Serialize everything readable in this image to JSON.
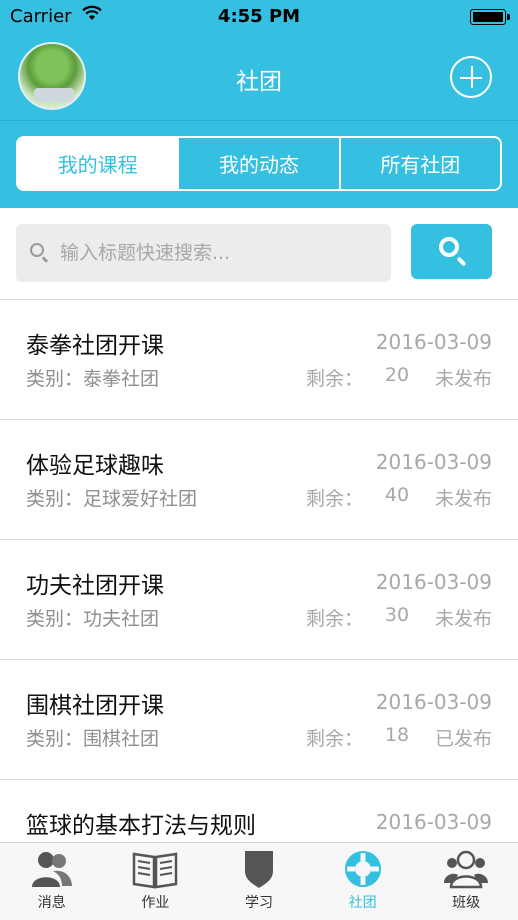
{
  "status_bar": {
    "carrier": "Carrier",
    "time": "4:55 PM"
  },
  "header": {
    "title": "社团"
  },
  "segments": {
    "items": [
      "我的课程",
      "我的动态",
      "所有社团"
    ],
    "active_index": 0
  },
  "search": {
    "placeholder": "输入标题快速搜索..."
  },
  "labels": {
    "category_prefix": "类别：",
    "remaining_prefix": "剩余："
  },
  "courses": [
    {
      "title": "泰拳社团开课",
      "date": "2016-03-09",
      "category": "泰拳社团",
      "remaining": "20",
      "status": "未发布"
    },
    {
      "title": "体验足球趣味",
      "date": "2016-03-09",
      "category": "足球爱好社团",
      "remaining": "40",
      "status": "未发布"
    },
    {
      "title": "功夫社团开课",
      "date": "2016-03-09",
      "category": "功夫社团",
      "remaining": "30",
      "status": "未发布"
    },
    {
      "title": "围棋社团开课",
      "date": "2016-03-09",
      "category": "围棋社团",
      "remaining": "18",
      "status": "已发布"
    },
    {
      "title": "篮球的基本打法与规则",
      "date": "2016-03-09"
    }
  ],
  "tabbar": {
    "items": [
      {
        "label": "消息",
        "icon": "people-icon"
      },
      {
        "label": "作业",
        "icon": "book-icon"
      },
      {
        "label": "学习",
        "icon": "shield-icon"
      },
      {
        "label": "社团",
        "icon": "lifebuoy-icon"
      },
      {
        "label": "班级",
        "icon": "group-icon"
      }
    ],
    "active_index": 3
  },
  "colors": {
    "accent": "#35bfe0",
    "text_primary": "#111111",
    "text_secondary": "#a8a8a8",
    "tab_inactive": "#555555"
  }
}
